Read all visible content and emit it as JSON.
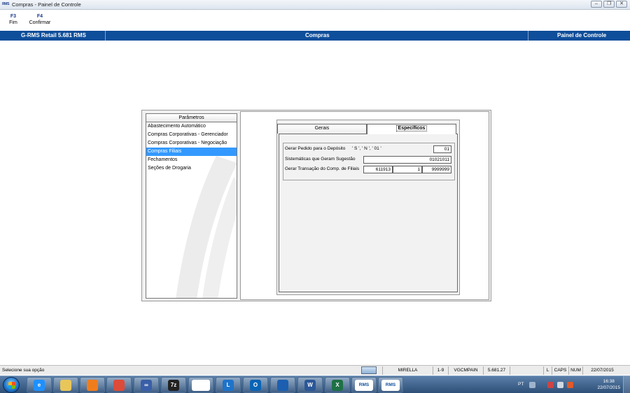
{
  "window": {
    "app_icon": "RMS",
    "title": "Compras - Painel de Controle",
    "controls": [
      "minimize-icon",
      "restore-icon",
      "close-icon"
    ]
  },
  "function_keys": [
    {
      "key": "F3",
      "label": "Fim"
    },
    {
      "key": "F4",
      "label": "Confirmar"
    }
  ],
  "header": {
    "left": "G-RMS Retail 5.681 RMS",
    "center": "Compras",
    "right": "Painel de Controle",
    "color": "#0e4e9a"
  },
  "parametros": {
    "title": "Parâmetros",
    "items": [
      {
        "label": "Abastecimento Automático",
        "selected": false
      },
      {
        "label": "Compras Corporativas - Gerenciador",
        "selected": false
      },
      {
        "label": "Compras Corporativas - Negociação",
        "selected": false
      },
      {
        "label": "Compras Filiais",
        "selected": true
      },
      {
        "label": "Fechamentos",
        "selected": false
      },
      {
        "label": "Seções de Drogaria",
        "selected": false
      }
    ],
    "selected_color": "#3399ff"
  },
  "tabs": [
    {
      "label": "Gerais",
      "active": false
    },
    {
      "label": "Específicos",
      "active": true
    }
  ],
  "form": {
    "gerar_pedido": {
      "label": "Gerar Pedido para o Depósito",
      "hint": "' S ', ' N ', ' 01 '",
      "value": "01"
    },
    "sistematicas": {
      "label": "Sistemáticas que Geram Sugestão",
      "value": "01021011"
    },
    "gerar_transacao": {
      "label": "Gerar Transação do Comp. de Filiais",
      "values": [
        "611913",
        "1",
        "9999999"
      ]
    }
  },
  "statusbar": {
    "message": "Selecione sua opção",
    "user": "MIRELLA",
    "range": "1-9",
    "program": "VGCMPAIN",
    "version": "5.681.27",
    "l": "L",
    "caps": "CAPS",
    "num": "NUM",
    "date": "22/07/2015"
  },
  "taskbar": {
    "apps": [
      {
        "name": "internet-explorer-icon",
        "label": "e",
        "color": "#1e90ff"
      },
      {
        "name": "file-explorer-icon",
        "label": "",
        "color": "#e8c65a"
      },
      {
        "name": "media-player-icon",
        "label": "",
        "color": "#f07d1c"
      },
      {
        "name": "chrome-icon",
        "label": "",
        "color": "#dd4b39"
      },
      {
        "name": "infinity-app-icon",
        "label": "∞",
        "color": "#3a5fa8"
      },
      {
        "name": "7zip-icon",
        "label": "7z",
        "color": "#222222"
      },
      {
        "name": "document-icon",
        "label": "",
        "color": "#ffffff"
      },
      {
        "name": "lync-icon",
        "label": "L",
        "color": "#1e73c9"
      },
      {
        "name": "outlook-icon",
        "label": "O",
        "color": "#0a64b5"
      },
      {
        "name": "remote-desktop-icon",
        "label": "",
        "color": "#1c5fb0"
      },
      {
        "name": "word-icon",
        "label": "W",
        "color": "#2b5797"
      },
      {
        "name": "excel-icon",
        "label": "X",
        "color": "#1e7145"
      },
      {
        "name": "rms-app-icon",
        "label": "RMS",
        "color": "#ffffff"
      },
      {
        "name": "rms-app-icon-2",
        "label": "RMS",
        "color": "#ffffff"
      }
    ],
    "language": "PT",
    "time": "16:38",
    "date": "22/07/2015"
  }
}
